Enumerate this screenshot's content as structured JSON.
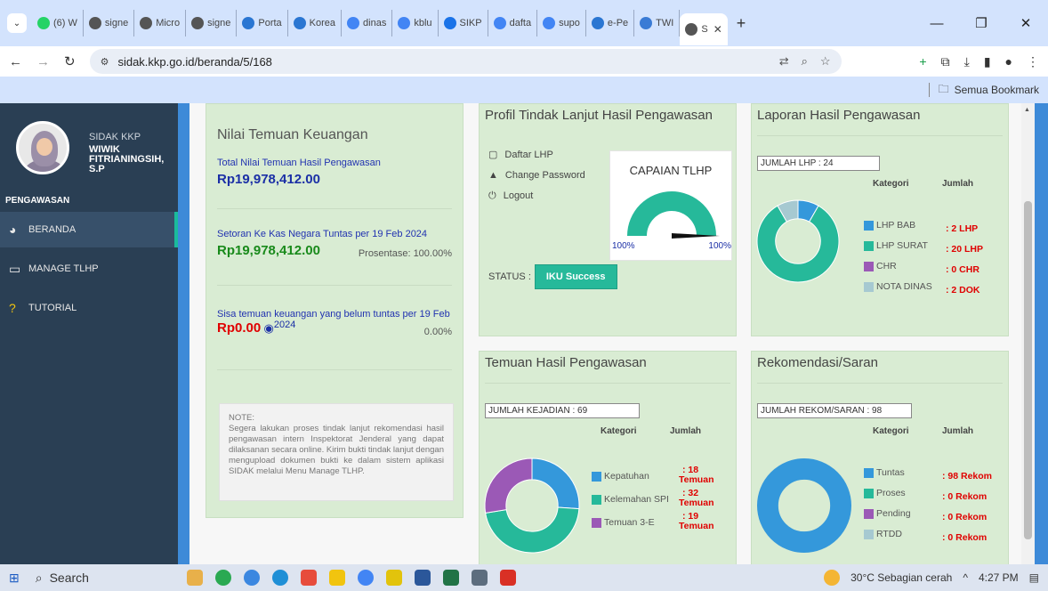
{
  "browser": {
    "tabs": [
      {
        "label": "(6) W",
        "color": "#25d366"
      },
      {
        "label": "signe",
        "color": "#555"
      },
      {
        "label": "Micro",
        "color": "#555"
      },
      {
        "label": "signe",
        "color": "#555"
      },
      {
        "label": "Porta",
        "color": "#2a76d2"
      },
      {
        "label": "Korea",
        "color": "#2a76d2"
      },
      {
        "label": "dinas",
        "color": "#4285f4"
      },
      {
        "label": "kblu",
        "color": "#4285f4"
      },
      {
        "label": "SIKP",
        "color": "#1a73e8"
      },
      {
        "label": "dafta",
        "color": "#4285f4"
      },
      {
        "label": "supo",
        "color": "#4285f4"
      },
      {
        "label": "e-Pe",
        "color": "#2a76d2"
      },
      {
        "label": "TWI",
        "color": "#3a7bd5"
      }
    ],
    "active_tab": {
      "label": "S",
      "color": "#555"
    },
    "url": "sidak.kkp.go.id/beranda/5/168",
    "bookmark_label": "Semua Bookmark"
  },
  "sidebar": {
    "app_name": "SIDAK KKP",
    "user_name": "WIWIK FITRIANINGSIH, S.P",
    "section": "PENGAWASAN",
    "items": [
      {
        "label": "BERANDA",
        "icon": "pie-chart-icon"
      },
      {
        "label": "MANAGE TLHP",
        "icon": "monitor-icon"
      },
      {
        "label": "TUTORIAL",
        "icon": "help-icon"
      }
    ]
  },
  "keuangan": {
    "title": "Nilai Temuan Keuangan",
    "total_label": "Total Nilai Temuan Hasil Pengawasan",
    "total_value": "Rp19,978,412.00",
    "setoran_label": "Setoran Ke Kas Negara Tuntas per 19 Feb 2024",
    "setoran_value": "Rp19,978,412.00",
    "setoran_pct": "Prosentase: 100.00%",
    "sisa_label": "Sisa temuan keuangan yang belum tuntas per 19 Feb",
    "sisa_value": "Rp0.00",
    "sisa_year": "2024",
    "sisa_pct": "0.00%",
    "note_title": "NOTE:",
    "note_text": "Segera lakukan proses tindak lanjut rekomendasi hasil pengawasan intern Inspektorat Jenderal yang dapat dilaksanan secara online. Kirim bukti tindak lanjut dengan mengupload dokumen bukti ke dalam sistem aplikasi SIDAK melalui Menu Manage TLHP."
  },
  "profil": {
    "title": "Profil Tindak Lanjut Hasil Pengawasan",
    "menu": [
      "Daftar LHP",
      "Change Password",
      "Logout"
    ],
    "gauge_title": "CAPAIAN TLHP",
    "gauge_min": "100%",
    "gauge_max": "100%",
    "gauge_value": 100,
    "status_label": "STATUS :",
    "status_value": "IKU Success"
  },
  "laporan": {
    "title": "Laporan Hasil Pengawasan",
    "jumlah": "JUMLAH LHP : 24",
    "col_kategori": "Kategori",
    "col_jumlah": "Jumlah",
    "rows": [
      {
        "label": "LHP BAB",
        "value": ": 2 LHP",
        "color": "#3498db",
        "n": 2
      },
      {
        "label": "LHP SURAT",
        "value": ": 20 LHP",
        "color": "#26b99a",
        "n": 20
      },
      {
        "label": "CHR",
        "value": ": 0 CHR",
        "color": "#9b59b6",
        "n": 0
      },
      {
        "label": "NOTA DINAS",
        "value": ": 2 DOK",
        "color": "#a6c9d1",
        "n": 2
      }
    ]
  },
  "temuan": {
    "title": "Temuan Hasil Pengawasan",
    "jumlah": "JUMLAH KEJADIAN : 69",
    "col_kategori": "Kategori",
    "col_jumlah": "Jumlah",
    "rows": [
      {
        "label": "Kepatuhan",
        "value": ": 18",
        "unit": "Temuan",
        "color": "#3498db",
        "n": 18
      },
      {
        "label": "Kelemahan SPI",
        "value": ": 32",
        "unit": "Temuan",
        "color": "#26b99a",
        "n": 32
      },
      {
        "label": "Temuan 3-E",
        "value": ": 19",
        "unit": "Temuan",
        "color": "#9b59b6",
        "n": 19
      }
    ]
  },
  "rekomendasi": {
    "title": "Rekomendasi/Saran",
    "jumlah": "JUMLAH REKOM/SARAN : 98",
    "col_kategori": "Kategori",
    "col_jumlah": "Jumlah",
    "rows": [
      {
        "label": "Tuntas",
        "value": ": 98 Rekom",
        "color": "#3498db",
        "n": 98
      },
      {
        "label": "Proses",
        "value": ": 0 Rekom",
        "color": "#26b99a",
        "n": 0
      },
      {
        "label": "Pending",
        "value": ": 0 Rekom",
        "color": "#9b59b6",
        "n": 0
      },
      {
        "label": "RTDD",
        "value": ": 0 Rekom",
        "color": "#a6c9d1",
        "n": 0
      }
    ]
  },
  "taskbar": {
    "search": "Search",
    "weather": "30°C  Sebagian cerah",
    "time": "4:27 PM"
  }
}
